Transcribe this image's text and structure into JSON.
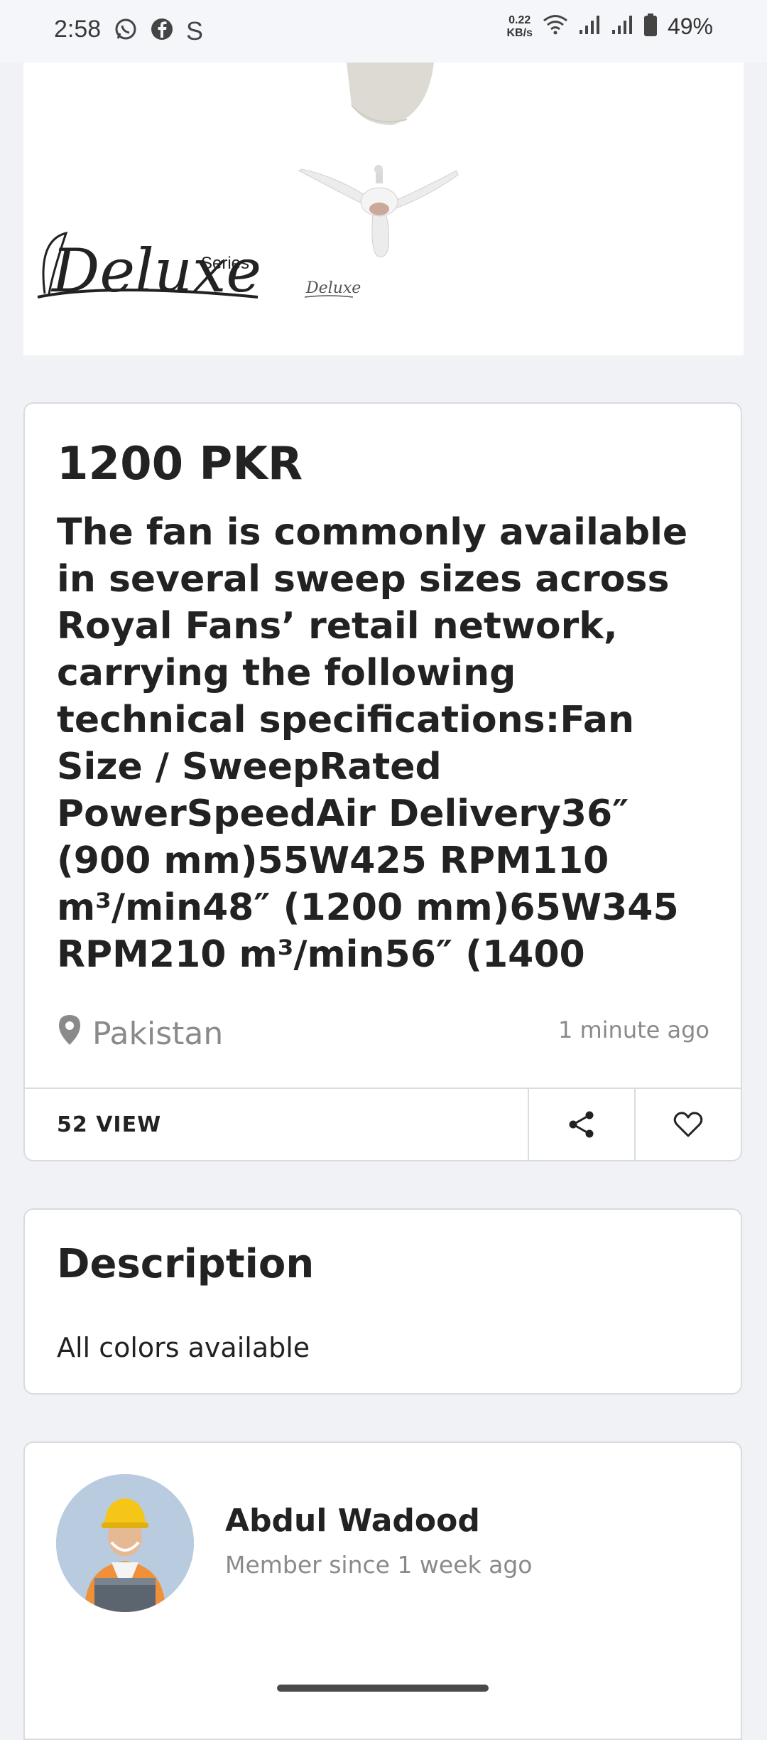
{
  "status_bar": {
    "time": "2:58",
    "net_speed_value": "0.22",
    "net_speed_unit": "KB/s",
    "battery": "49%",
    "left_icons": [
      "whatsapp-icon",
      "facebook-icon",
      "s-app-icon"
    ],
    "right_icons": [
      "wifi-icon",
      "signal-icon",
      "signal-icon",
      "battery-icon"
    ]
  },
  "product_image": {
    "brand_series": "Series",
    "brand_name": "Deluxe",
    "small_brand": "Deluxe"
  },
  "listing": {
    "price": "1200 PKR",
    "title": "The fan is commonly available in several sweep sizes across Royal Fans’ retail network, carrying the following technical specifications:Fan Size / SweepRated PowerSpeedAir Delivery36″ (900 mm)55W425 RPM110 m³/min48″ (1200 mm)65W345 RPM210 m³/min56″ (1400",
    "location": "Pakistan",
    "posted": "1 minute ago",
    "views": "52 VIEW"
  },
  "description": {
    "heading": "Description",
    "text": "All colors available"
  },
  "seller": {
    "name": "Abdul Wadood",
    "member_since": "Member since 1 week ago"
  },
  "colors": {
    "background": "#f1f2f6",
    "card": "#ffffff",
    "border": "#dadbe0",
    "muted_text": "#8a8a8a"
  }
}
